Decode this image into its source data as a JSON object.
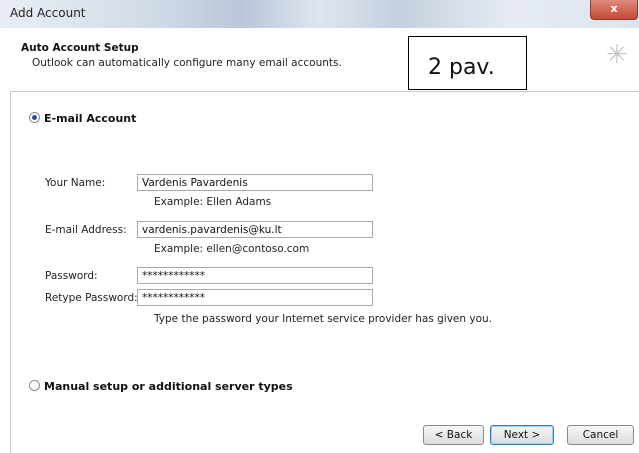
{
  "window": {
    "title": "Add Account",
    "close_label": "x"
  },
  "header": {
    "title": "Auto Account Setup",
    "subtitle": "Outlook can automatically configure many email accounts.",
    "note": "2 pav."
  },
  "options": {
    "email_account": "E-mail Account",
    "manual_setup": "Manual setup or additional server types"
  },
  "form": {
    "name_label": "Your Name:",
    "name_value": "Vardenis Pavardenis",
    "name_hint": "Example: Ellen Adams",
    "email_label": "E-mail Address:",
    "email_value": "vardenis.pavardenis@ku.lt",
    "email_hint": "Example: ellen@contoso.com",
    "password_label": "Password:",
    "password_value": "************",
    "retype_label": "Retype Password:",
    "retype_value": "************",
    "password_hint": "Type the password your Internet service provider has given you."
  },
  "buttons": {
    "back": "< Back",
    "next": "Next >",
    "cancel": "Cancel"
  }
}
